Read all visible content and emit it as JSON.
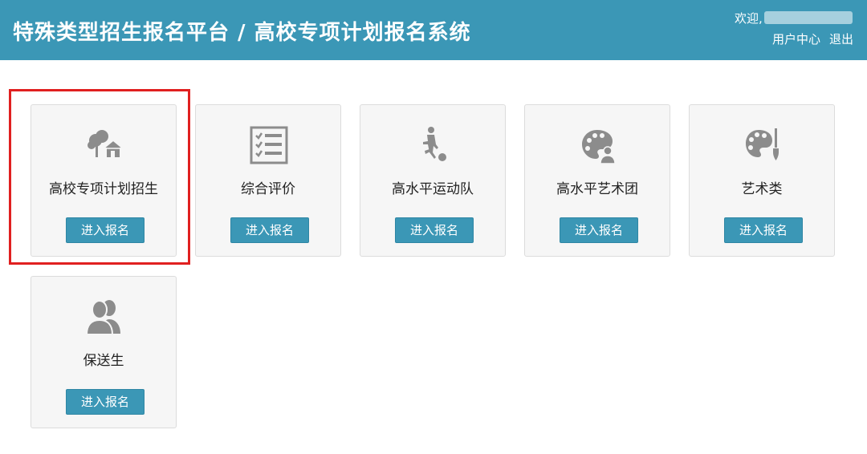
{
  "header": {
    "title": "特殊类型招生报名平台 / 高校专项计划报名系统",
    "welcome": "欢迎,",
    "user_center": "用户中心",
    "logout": "退出"
  },
  "cards": [
    {
      "label": "高校专项计划招生",
      "button": "进入报名",
      "icon": "tree-house-icon"
    },
    {
      "label": "综合评价",
      "button": "进入报名",
      "icon": "checklist-icon"
    },
    {
      "label": "高水平运动队",
      "button": "进入报名",
      "icon": "soccer-player-icon"
    },
    {
      "label": "高水平艺术团",
      "button": "进入报名",
      "icon": "palette-person-icon"
    },
    {
      "label": "艺术类",
      "button": "进入报名",
      "icon": "palette-brush-icon"
    },
    {
      "label": "保送生",
      "button": "进入报名",
      "icon": "users-icon"
    }
  ],
  "colors": {
    "header_bg": "#3b97b6",
    "button_bg": "#3b97b6",
    "highlight": "#e02020",
    "icon": "#8c8c8c"
  }
}
